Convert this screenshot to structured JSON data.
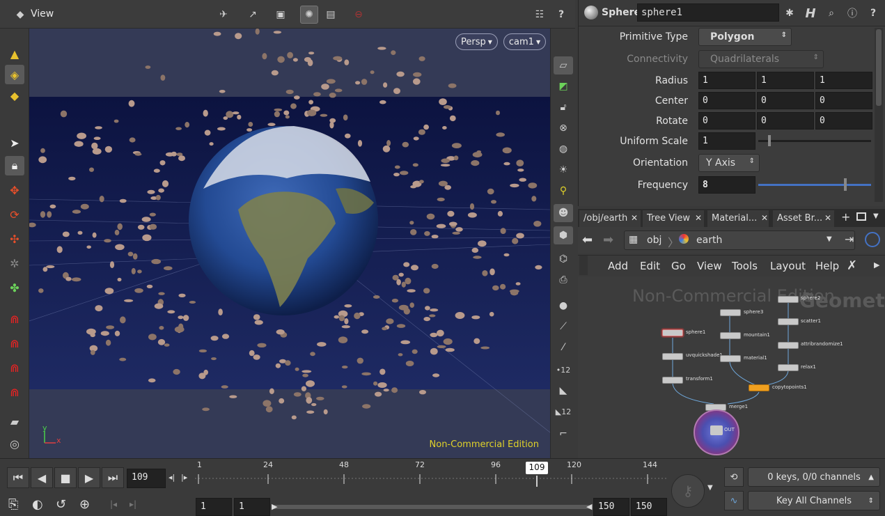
{
  "viewport": {
    "title": "View",
    "persp_label": "Persp",
    "cam_label": "cam1",
    "watermark": "Non-Commercial Edition",
    "axis_y": "y",
    "axis_x": "x"
  },
  "params": {
    "node_type": "Sphere",
    "node_name": "sphere1",
    "primitive_type_label": "Primitive Type",
    "primitive_type_value": "Polygon",
    "connectivity_label": "Connectivity",
    "connectivity_value": "Quadrilaterals",
    "radius_label": "Radius",
    "radius": [
      "1",
      "1",
      "1"
    ],
    "center_label": "Center",
    "center": [
      "0",
      "0",
      "0"
    ],
    "rotate_label": "Rotate",
    "rotate": [
      "0",
      "0",
      "0"
    ],
    "uniform_scale_label": "Uniform Scale",
    "uniform_scale": "1",
    "orientation_label": "Orientation",
    "orientation_value": "Y Axis",
    "frequency_label": "Frequency",
    "frequency": "8"
  },
  "network": {
    "tabs": [
      "/obj/earth",
      "Tree View",
      "Material...",
      "Asset Br..."
    ],
    "path_obj": "obj",
    "path_earth": "earth",
    "menu": [
      "Add",
      "Edit",
      "Go",
      "View",
      "Tools",
      "Layout",
      "Help"
    ],
    "watermark": "Non-Commercial Edition",
    "context_label": "Geometry",
    "nodes": [
      "sphere1",
      "uvquickshade1",
      "transform1",
      "sphere3",
      "mountain1",
      "material1",
      "sphere2",
      "scatter1",
      "attribrandomize1",
      "relax1",
      "copytopoints1",
      "merge1",
      "OUT"
    ]
  },
  "timeline": {
    "current_frame": "109",
    "marker": "109",
    "ticks": [
      "1",
      "24",
      "48",
      "72",
      "96",
      "120",
      "144"
    ],
    "start": "1",
    "start2": "1",
    "end": "150",
    "end2": "150",
    "keys_status": "0 keys, 0/0 channels",
    "key_all": "Key All Channels"
  }
}
